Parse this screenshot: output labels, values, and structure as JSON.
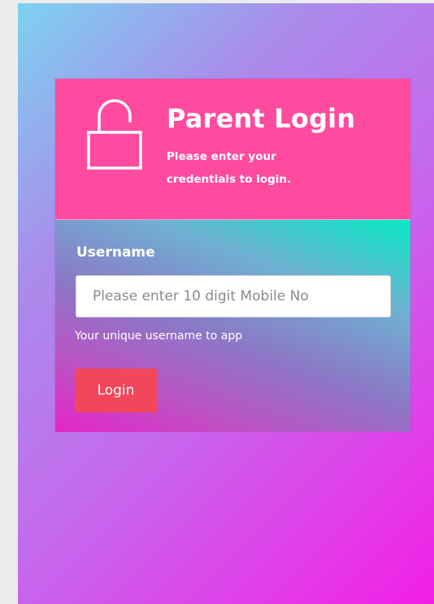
{
  "header": {
    "title": "Parent Login",
    "subtitle": "Please enter your credentials to login.",
    "icon": "unlocked-padlock-icon"
  },
  "form": {
    "username_label": "Username",
    "username_placeholder": "Please enter 10 digit Mobile No",
    "username_value": "",
    "help_text": "Your unique username to app",
    "login_label": "Login"
  },
  "colors": {
    "header_background": "#fe4ba0",
    "login_button": "#f2465b",
    "text": "#ffffff"
  }
}
